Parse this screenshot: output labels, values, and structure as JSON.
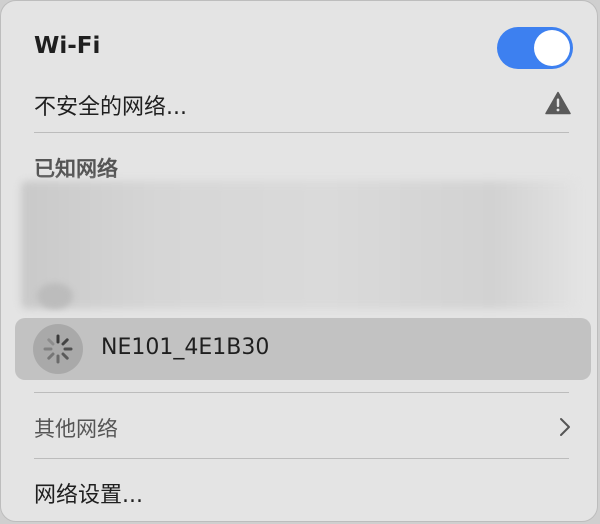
{
  "wifi": {
    "title": "Wi-Fi",
    "enabled": true,
    "toggle_icon": "toggle-switch-on",
    "accent_color": "#3d80f0"
  },
  "insecure": {
    "label": "不安全的网络...",
    "icon": "warning-icon"
  },
  "known": {
    "header": "已知网络",
    "networks": [
      {
        "name": "NE101_4E1B30",
        "status_icon": "spinner-icon",
        "connecting": true
      }
    ]
  },
  "other": {
    "label": "其他网络",
    "icon": "chevron-right-icon"
  },
  "settings": {
    "label": "网络设置..."
  }
}
